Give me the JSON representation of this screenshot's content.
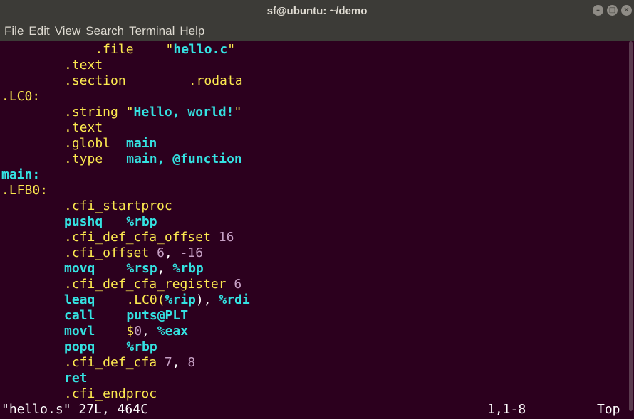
{
  "window": {
    "title": "sf@ubuntu: ~/demo",
    "minimize_glyph": "–",
    "maximize_glyph": "□",
    "close_glyph": "✕"
  },
  "menu": [
    "File",
    "Edit",
    "View",
    "Search",
    "Terminal",
    "Help"
  ],
  "code": {
    "l1": [
      "    .file",
      "\"",
      "hello.c",
      "\""
    ],
    "l2": ".text",
    "l3": [
      ".section",
      ".rodata"
    ],
    "l4": ".LC0:",
    "l5": [
      ".string",
      "\"",
      "Hello, world!",
      "\""
    ],
    "l6": ".text",
    "l7": [
      ".globl",
      "main"
    ],
    "l8": [
      ".type",
      "main, @function"
    ],
    "l9": "main:",
    "l10": ".LFB0:",
    "l11": ".cfi_startproc",
    "l12": [
      "pushq",
      "%rbp"
    ],
    "l13": [
      ".cfi_def_cfa_offset",
      "16"
    ],
    "l14": [
      ".cfi_offset",
      "6",
      ",",
      "-16"
    ],
    "l15": [
      "movq",
      "%rsp",
      ",",
      "%rbp"
    ],
    "l16": [
      ".cfi_def_cfa_register",
      "6"
    ],
    "l17": [
      "leaq",
      ".LC0(",
      "%rip",
      "), ",
      "%rdi"
    ],
    "l18": [
      "call",
      "puts@PLT"
    ],
    "l19": [
      "movl",
      "$",
      "0",
      ", ",
      "%eax"
    ],
    "l20": [
      "popq",
      "%rbp"
    ],
    "l21": [
      ".cfi_def_cfa",
      "7",
      ",",
      "8"
    ],
    "l22": "ret",
    "l23": ".cfi_endproc"
  },
  "status": {
    "file_info": "\"hello.s\" 27L, 464C",
    "cursor_position": "1,1-8",
    "scroll_position": "Top"
  },
  "colors": {
    "background": "#2c001e",
    "keyword": "#fce94f",
    "identifier": "#34e2e2",
    "number": "#c6a0c4",
    "titlebar": "#3c3b37"
  }
}
